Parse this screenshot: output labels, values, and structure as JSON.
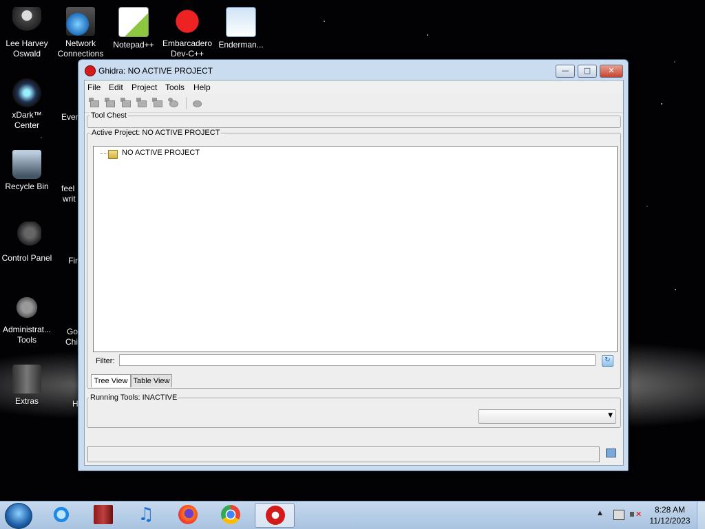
{
  "desktop": {
    "icons": [
      {
        "label": "Lee Harvey\nOswald",
        "icon": "user-figure-icon"
      },
      {
        "label": "Network\nConnections",
        "icon": "network-globe-icon"
      },
      {
        "label": "Notepad++",
        "icon": "notepad-icon"
      },
      {
        "label": "Embarcadero\nDev-C++",
        "icon": "devcpp-icon"
      },
      {
        "label": "Enderman...",
        "icon": "program-window-icon"
      },
      {
        "label": "xDark™\nCenter",
        "icon": "xdark-orb-icon"
      },
      {
        "label": "Recycle Bin",
        "icon": "recycle-bin-icon"
      },
      {
        "label": "Control Panel",
        "icon": "control-panel-icon"
      },
      {
        "label": "Administrat...\nTools",
        "icon": "admin-tools-icon"
      },
      {
        "label": "Extras",
        "icon": "extras-folder-icon"
      }
    ],
    "partial_labels": [
      "Ever",
      "feel",
      "writ",
      "Fir",
      "Go",
      "Chi",
      "H"
    ]
  },
  "window": {
    "title": "Ghidra: NO ACTIVE PROJECT",
    "controls": {
      "minimize": "—",
      "maximize": "□",
      "close": "✕"
    },
    "menu": [
      "File",
      "Edit",
      "Project",
      "Tools",
      "Help"
    ],
    "toolbar_icons": [
      "tool-icon-1",
      "tool-icon-2",
      "tool-icon-3",
      "tool-icon-4",
      "tool-icon-5",
      "tool-icon-6",
      "refresh-icon"
    ],
    "tool_chest_label": "Tool Chest",
    "active_project_label": "Active Project: NO ACTIVE PROJECT",
    "tree_root": "NO ACTIVE PROJECT",
    "filter_label": "Filter:",
    "filter_value": "",
    "tabs": [
      "Tree View",
      "Table View"
    ],
    "active_tab": "Tree View",
    "running_tools_label": "Running Tools: INACTIVE"
  },
  "taskbar": {
    "apps": [
      "ie-icon",
      "archive-icon",
      "music-icon",
      "firefox-icon",
      "chrome-icon",
      "ghidra-icon"
    ],
    "active_app": "ghidra-icon",
    "time": "8:28 AM",
    "date": "11/12/2023",
    "tray_arrow": "▲"
  }
}
